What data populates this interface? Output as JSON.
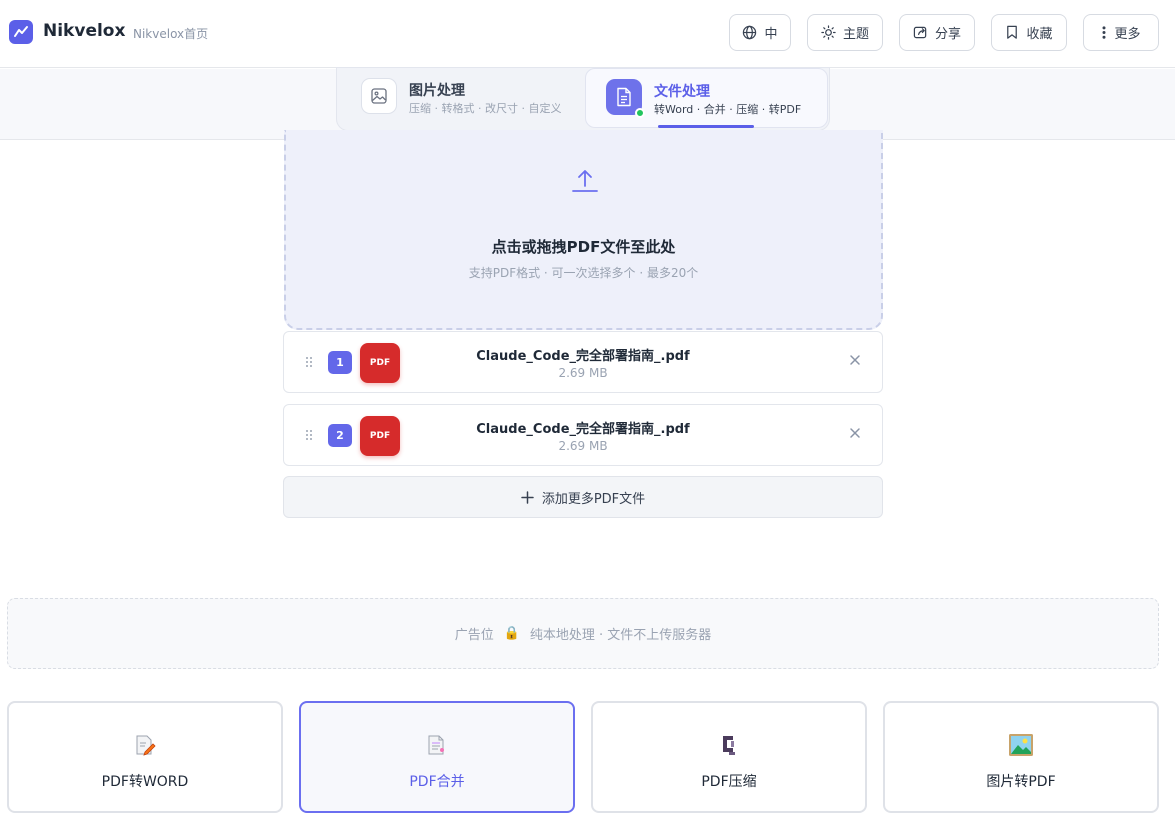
{
  "header": {
    "brand": "Nikvelox",
    "home_link": "Nikvelox首页",
    "buttons": {
      "language": "中",
      "theme": "主题",
      "share": "分享",
      "bookmark": "收藏",
      "more": "更多"
    }
  },
  "tabs": [
    {
      "title": "图片处理",
      "subtitle": "压缩 · 转格式 · 改尺寸 · 自定义",
      "active": false
    },
    {
      "title": "文件处理",
      "subtitle": "转Word · 合并 · 压缩 · 转PDF",
      "active": true
    }
  ],
  "dropzone": {
    "title": "点击或拖拽PDF文件至此处",
    "subtitle": "支持PDF格式 · 可一次选择多个 · 最多20个"
  },
  "files": [
    {
      "index": "1",
      "type": "PDF",
      "name": "Claude_Code_完全部署指南_.pdf",
      "size": "2.69 MB"
    },
    {
      "index": "2",
      "type": "PDF",
      "name": "Claude_Code_完全部署指南_.pdf",
      "size": "2.69 MB"
    }
  ],
  "add_more": "添加更多PDF文件",
  "ad_bar": {
    "label": "广告位",
    "notice": "纯本地处理 · 文件不上传服务器"
  },
  "tools": [
    {
      "label": "PDF转WORD",
      "icon": "pencil-doc-icon",
      "active": false
    },
    {
      "label": "PDF合并",
      "icon": "merge-doc-icon",
      "active": true
    },
    {
      "label": "PDF压缩",
      "icon": "clamp-icon",
      "active": false
    },
    {
      "label": "图片转PDF",
      "icon": "picture-icon",
      "active": false
    }
  ],
  "colors": {
    "accent": "#5b5fe8",
    "pdf_red": "#d62b2b",
    "online_green": "#22c55e"
  }
}
